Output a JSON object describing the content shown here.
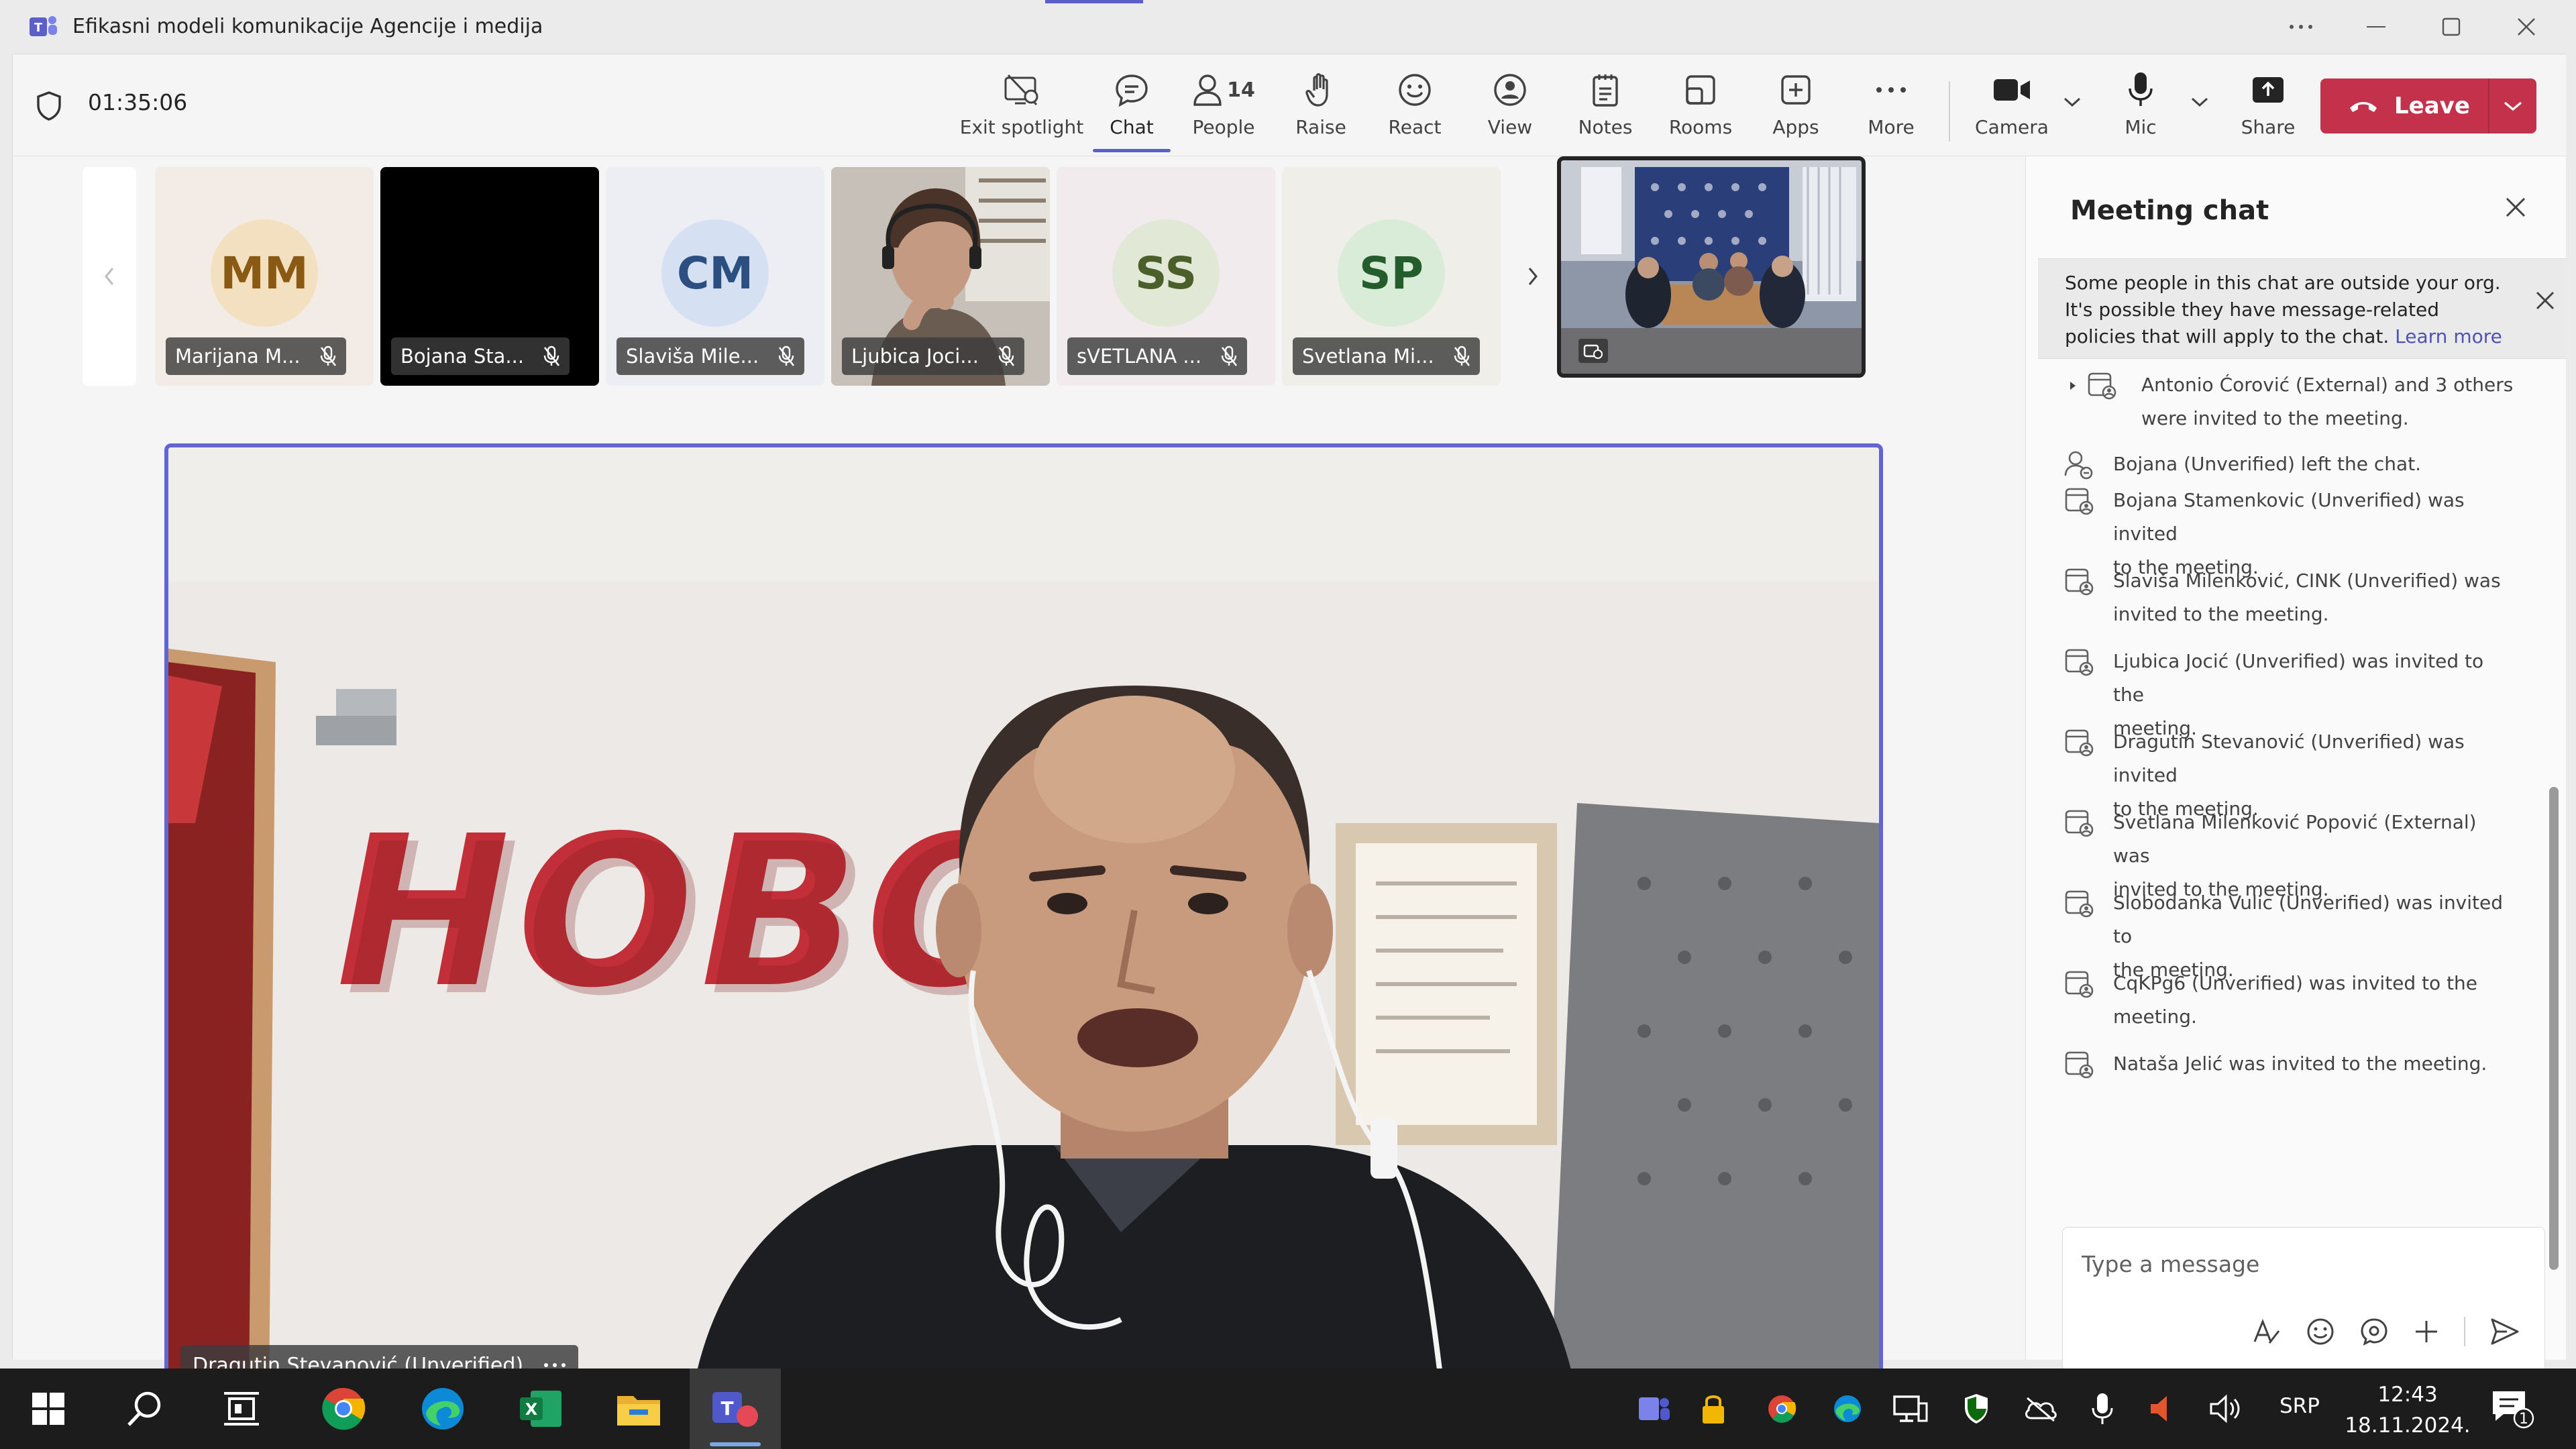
{
  "window": {
    "title": "Efikasni modeli komunikacije Agencije i medija"
  },
  "meeting": {
    "elapsed": "01:35:06",
    "people_count": "14"
  },
  "toolbar": {
    "exit_spotlight": "Exit spotlight",
    "chat": "Chat",
    "people": "People",
    "raise": "Raise",
    "react": "React",
    "view": "View",
    "notes": "Notes",
    "rooms": "Rooms",
    "apps": "Apps",
    "more": "More",
    "camera": "Camera",
    "mic": "Mic",
    "share": "Share",
    "leave": "Leave"
  },
  "participants": [
    {
      "initials": "MM",
      "name": "Marijana M...",
      "bg": "#f3ebe6",
      "avatar_bg": "#f2e0c0",
      "avatar_fg": "#8a5a14"
    },
    {
      "initials": "",
      "name": "Bojana Sta...",
      "bg": "#000000",
      "avatar_bg": "",
      "avatar_fg": ""
    },
    {
      "initials": "CM",
      "name": "Slaviša Mile...",
      "bg": "#eceef3",
      "avatar_bg": "#d5e1f2",
      "avatar_fg": "#2b4f80"
    },
    {
      "initials": "",
      "name": "Ljubica Joci...",
      "bg": "#b9b2ac",
      "avatar_bg": "",
      "avatar_fg": ""
    },
    {
      "initials": "SS",
      "name": "sVETLANA ...",
      "bg": "#f1ebee",
      "avatar_bg": "#e1e8d6",
      "avatar_fg": "#4b5f2a"
    },
    {
      "initials": "SP",
      "name": "Svetlana Mi...",
      "bg": "#efeee8",
      "avatar_bg": "#d8ecd8",
      "avatar_fg": "#245c2b"
    }
  ],
  "main_video": {
    "name": "Dragutin Stevanović (Unverified)"
  },
  "chat": {
    "title": "Meeting chat",
    "banner_text": "Some people in this chat are outside your org. It's possible they have message-related policies that will apply to the chat.",
    "banner_link": "Learn more",
    "messages": [
      {
        "line1": "Antonio Ćorović (External) and 3 others",
        "line2": "were invited to the meeting."
      },
      {
        "line1": "Bojana (Unverified) left the chat.",
        "line2": ""
      },
      {
        "line1": "Bojana Stamenkovic (Unverified) was invited",
        "line2": "to the meeting."
      },
      {
        "line1": "Slaviša Milenković, CINK (Unverified) was",
        "line2": "invited to the meeting."
      },
      {
        "line1": "Ljubica Jocić (Unverified) was invited to the",
        "line2": "meeting."
      },
      {
        "line1": "Dragutin Stevanović (Unverified) was invited",
        "line2": "to the meeting."
      },
      {
        "line1": "Svetlana Milenković Popović (External) was",
        "line2": "invited to the meeting."
      },
      {
        "line1": "Slobodanka Vulic (Unverified) was invited to",
        "line2": "the meeting."
      },
      {
        "line1": "CqKPg6 (Unverified) was invited to the",
        "line2": "meeting."
      },
      {
        "line1": "Nataša Jelić was invited to the meeting.",
        "line2": ""
      }
    ],
    "compose_placeholder": "Type a message"
  },
  "taskbar": {
    "language": "SRP",
    "time": "12:43",
    "date": "18.11.2024.",
    "notifications": "1"
  },
  "colors": {
    "accent": "#5b5fc7",
    "leave": "#c4314b",
    "spotlight_border": "#6264d6"
  }
}
